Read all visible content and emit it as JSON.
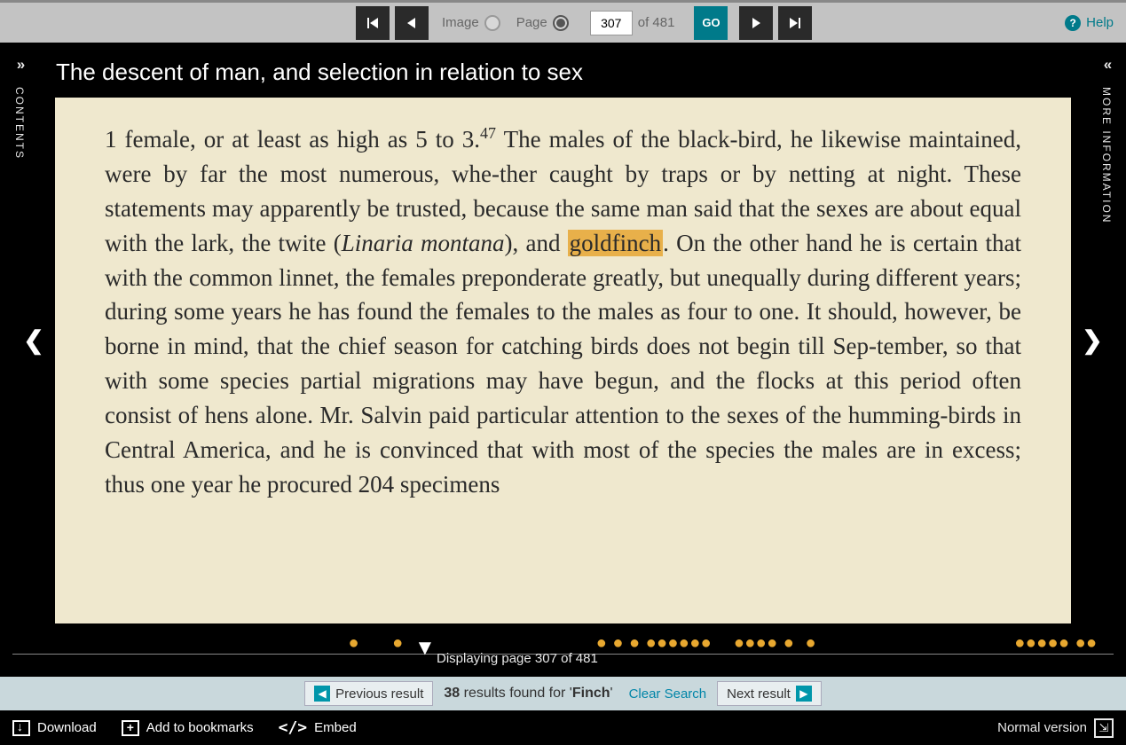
{
  "nav": {
    "image_label": "Image",
    "page_label": "Page",
    "page_value": "307",
    "of_label": "of 481",
    "go_label": "GO",
    "help_label": "Help"
  },
  "title": "The descent of man, and selection in relation to sex",
  "panels": {
    "left_label": "CONTENTS",
    "right_label": "MORE INFORMATION"
  },
  "page_text": {
    "pre": "1 female, or at least as high as 5 to 3.",
    "sup": "47",
    "mid1": " The males of the black-bird, he likewise maintained, were by far the most numerous, whe-ther caught by traps or by netting at night. These statements may apparently be trusted, because the same man said that the sexes are about equal with the lark, the twite (",
    "italic": "Linaria montana",
    "mid2": "), and ",
    "highlight": "goldfinch",
    "post": ". On the other hand he is certain that with the common linnet, the females preponderate greatly, but unequally during different years; during some years he has found the females to the males as four to one. It should, however, be borne in mind, that the chief season for catching birds does not begin till Sep-tember, so that with some species partial migrations may have begun, and the flocks at this period often consist of hens alone. Mr. Salvin paid particular attention to the sexes of the humming-birds in Central America, and he is convinced that with most of the species the males are in excess; thus one year he procured 204 specimens"
  },
  "timeline": {
    "displaying": "Displaying page 307 of 481"
  },
  "results": {
    "prev_label": "Previous result",
    "count": "38",
    "text1": " results found for '",
    "term": "Finch",
    "text2": "'",
    "clear_label": "Clear Search",
    "next_label": "Next result"
  },
  "bottom": {
    "download": "Download",
    "bookmarks": "Add to bookmarks",
    "embed": "Embed",
    "normal": "Normal version"
  }
}
